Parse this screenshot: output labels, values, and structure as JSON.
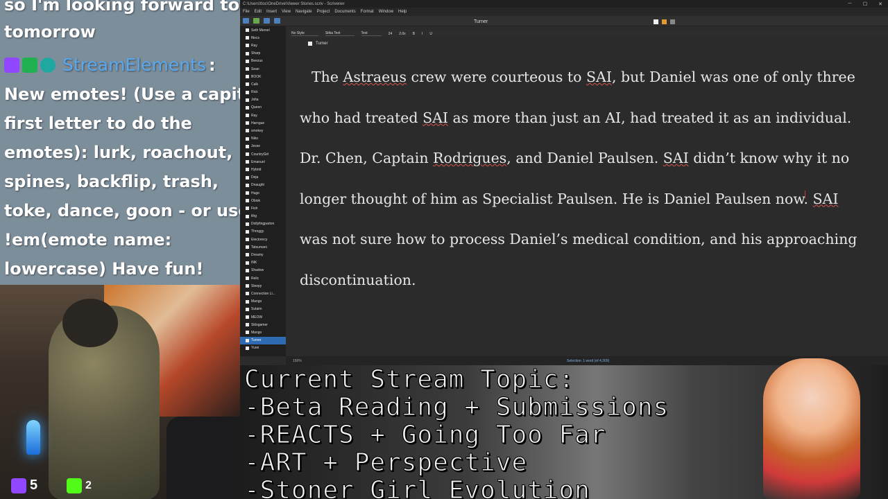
{
  "chat": {
    "prev_line_1": "so I'm looking forward to",
    "prev_line_2": "tomorrow",
    "username": "StreamElements",
    "separator": ":",
    "message_lines": [
      "New emotes! (Use a capital",
      "first letter to do the",
      "emotes): lurk, roachout,",
      "spines, backflip, trash,",
      "toke, dance, goon - or use",
      "!em(emote name:",
      "lowercase) Have fun!"
    ]
  },
  "stream": {
    "twitch_viewers": "5",
    "kick_viewers": "2",
    "topic_lines": [
      "Current Stream Topic:",
      "-Beta Reading + Submissions",
      "-REACTS + Going Too Far",
      "-ART + Perspective",
      "-Stoner Girl Evolution"
    ]
  },
  "window": {
    "title": "C:\\Users\\ttoc\\OneDrive\\Viewer Stories.scriv - Scrivener",
    "menu": [
      "File",
      "Edit",
      "Insert",
      "View",
      "Navigate",
      "Project",
      "Documents",
      "Format",
      "Window",
      "Help"
    ],
    "doc_title": "Turner",
    "style": "No Style",
    "font": "Sitka Text",
    "font_style": "Text",
    "font_size": "24",
    "line_spacing": "2.0x",
    "header_title": "Turner",
    "zoom": "150%",
    "selection_info": "Selection: 1 word (of 4,309)"
  },
  "binder": {
    "items": [
      "Seth Mersel",
      "fttocs",
      "Ray",
      "Sharp",
      "Beezus",
      "Sean",
      "BOOK",
      "Calk",
      "Rick",
      "Jolta",
      "Queen",
      "Ray",
      "Harngue",
      "smokey",
      "Niko",
      "Jesse",
      "CountryGirl",
      "Emanuel",
      "Hybrid",
      "Deja",
      "Dnaught",
      "Hugo",
      "Obiok",
      "Fish",
      "tllrg",
      "Dollyfingparton",
      "Throggy",
      "Electrency",
      "Tatsumani",
      "Dreamy",
      "INK",
      "Shadow",
      "Relic",
      "Sleepy",
      "Connection Li...",
      "Mango",
      "Sutaim",
      "MEOW",
      "Sklogamer",
      "Mango",
      "Turner",
      "Yurei"
    ],
    "selected_index": 40
  },
  "editor": {
    "segments": [
      {
        "t": "The ",
        "s": false
      },
      {
        "t": "Astraeus",
        "s": true
      },
      {
        "t": " crew were courteous to ",
        "s": false
      },
      {
        "t": "SAI",
        "s": true
      },
      {
        "t": ", but Daniel was one of only three who had treated ",
        "s": false
      },
      {
        "t": "SAI",
        "s": true
      },
      {
        "t": " as more than just an AI, had treated it as an individual. Dr. Chen, Captain ",
        "s": false
      },
      {
        "t": "Rodrigues",
        "s": true
      },
      {
        "t": ", and Daniel Paulsen. ",
        "s": false
      },
      {
        "t": "SAI",
        "s": true
      },
      {
        "t": " didn’t know why it no longer thought of him as Specialist Paulsen. He is Daniel Paulsen now. ",
        "s": false
      },
      {
        "t": "SAI",
        "s": true
      },
      {
        "t": " was not sure how to process Daniel’s medical condition, and his approaching discontinuation.",
        "s": false
      }
    ]
  }
}
